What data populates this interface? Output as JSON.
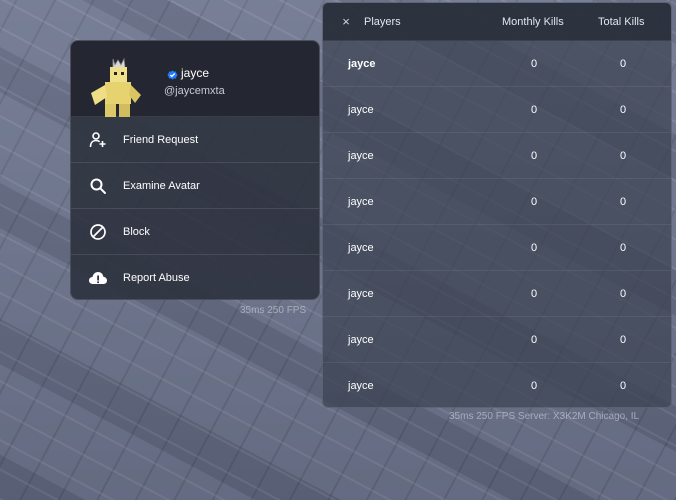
{
  "profile": {
    "display_name": "jayce",
    "username": "@jaycemxta",
    "menu": [
      {
        "label": "Friend Request",
        "icon": "add-friend-icon"
      },
      {
        "label": "Examine Avatar",
        "icon": "search-icon"
      },
      {
        "label": "Block",
        "icon": "block-icon"
      },
      {
        "label": "Report Abuse",
        "icon": "report-abuse-icon"
      }
    ]
  },
  "stats_left": "35ms  250 FPS",
  "players": {
    "title": "Players",
    "close_glyph": "×",
    "columns": {
      "monthly": "Monthly Kills",
      "total": "Total Kills"
    },
    "rows": [
      {
        "name": "jayce",
        "monthly": "0",
        "total": "0"
      },
      {
        "name": "jayce",
        "monthly": "0",
        "total": "0"
      },
      {
        "name": "jayce",
        "monthly": "0",
        "total": "0"
      },
      {
        "name": "jayce",
        "monthly": "0",
        "total": "0"
      },
      {
        "name": "jayce",
        "monthly": "0",
        "total": "0"
      },
      {
        "name": "jayce",
        "monthly": "0",
        "total": "0"
      },
      {
        "name": "jayce",
        "monthly": "0",
        "total": "0"
      },
      {
        "name": "jayce",
        "monthly": "0",
        "total": "0"
      }
    ]
  },
  "stats_right": "35ms  250 FPS  Server: X3K2M  Chicago, IL",
  "colors": {
    "verified": "#1f7bff",
    "avatar": "#e8d77a"
  }
}
